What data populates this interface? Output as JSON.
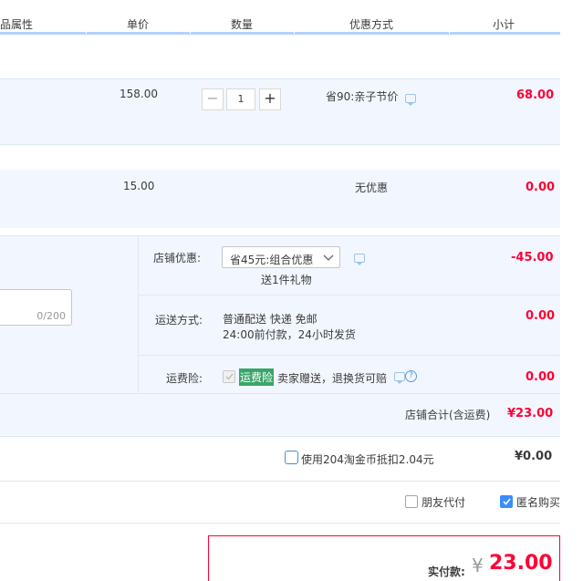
{
  "header": {
    "col_attr": "品属性",
    "col_price": "单价",
    "col_qty": "数量",
    "col_promo": "优惠方式",
    "col_subtotal": "小计"
  },
  "items": [
    {
      "price": "158.00",
      "quantity": "1",
      "promo": "省90:亲子节价",
      "subtotal": "68.00"
    },
    {
      "price": "15.00",
      "promo": "无优惠",
      "subtotal": "0.00"
    }
  ],
  "shop": {
    "discount_label": "店铺优惠:",
    "discount_select": "省45元:组合优惠",
    "gift_text": "送1件礼物",
    "discount_amount": "-45.00",
    "memo_counter": "0/200",
    "shipping_label": "运送方式:",
    "shipping_method": "普通配送 快递 免邮",
    "shipping_note": "24:00前付款，24小时发货",
    "shipping_amount": "0.00",
    "insurance_label": "运费险:",
    "insurance_tag": "运费险",
    "insurance_text": "卖家赠送，退换货可赔",
    "insurance_amount": "0.00",
    "shop_total_label": "店铺合计(含运费)",
    "shop_total": "¥23.00"
  },
  "taojinbi": {
    "label": "使用204淘金币抵扣2.04元",
    "amount": "¥0.00"
  },
  "options": {
    "friend_pay": "朋友代付",
    "anonymous": "匿名购买"
  },
  "payment": {
    "label": "实付款:",
    "currency": "¥",
    "amount": "23.00"
  },
  "colors": {
    "accent": "#ff0036",
    "header_line": "#b2d1ff",
    "band": "#f2f7ff",
    "check_blue": "#3b8cff",
    "tag_green": "#3aa56a"
  }
}
